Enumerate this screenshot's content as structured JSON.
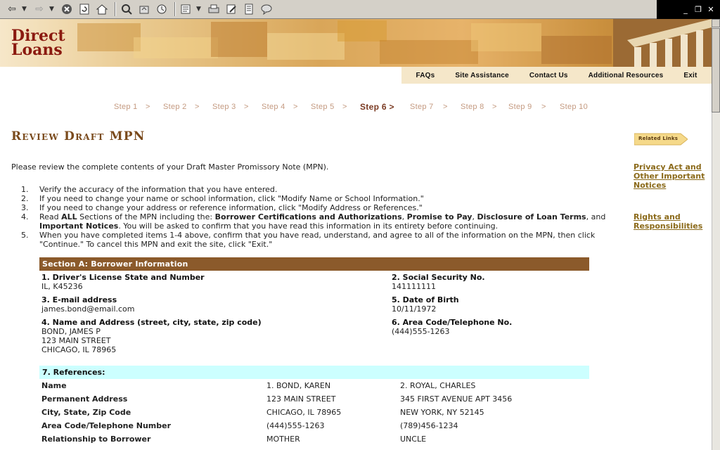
{
  "browser": {
    "toolbar_icons": [
      "back-arrow-icon",
      "dropdown-arrow-icon",
      "forward-arrow-icon",
      "dropdown-arrow-icon",
      "stop-icon",
      "refresh-icon",
      "home-icon",
      "search-icon",
      "favorites-icon",
      "history-icon",
      "mail-icon",
      "print-icon",
      "edit-icon",
      "discuss-icon",
      "messenger-icon"
    ],
    "window_controls": [
      "_",
      "❐",
      "✕"
    ]
  },
  "banner": {
    "logo_line1": "Direct",
    "logo_line2": "Loans"
  },
  "nav": [
    "FAQs",
    "Site Assistance",
    "Contact Us",
    "Additional Resources",
    "Exit"
  ],
  "steps": [
    {
      "label": "Step 1",
      "active": false
    },
    {
      "label": "Step 2",
      "active": false
    },
    {
      "label": "Step 3",
      "active": false
    },
    {
      "label": "Step 4",
      "active": false
    },
    {
      "label": "Step 5",
      "active": false
    },
    {
      "label": "Step 6 >",
      "active": true
    },
    {
      "label": "Step 7",
      "active": false
    },
    {
      "label": "Step 8",
      "active": false
    },
    {
      "label": "Step 9",
      "active": false
    },
    {
      "label": "Step 10",
      "active": false
    }
  ],
  "page_title": "Review Draft MPN",
  "related_links_label": "Related Links",
  "side_links": [
    "Privacy Act and Other Important Notices",
    "Rights and Responsibilities"
  ],
  "intro": "Please review the complete contents of your Draft Master Promissory Note (MPN).",
  "instructions": {
    "i1": "Verify the accuracy of the information that you have entered.",
    "i2": "If you need to change your name or school information, click \"Modify Name or School Information.\"",
    "i3": "If you need to change your address or reference information, click \"Modify Address or References.\"",
    "i4_a": "Read ",
    "i4_b": "ALL",
    "i4_c": " Sections of the MPN including the: ",
    "i4_d": "Borrower Certifications and Authorizations",
    "i4_e": ", ",
    "i4_f": "Promise to Pay",
    "i4_g": ", ",
    "i4_h": "Disclosure of Loan Terms",
    "i4_i": ", and ",
    "i4_j": "Important Notices",
    "i4_k": ". You will be asked to confirm that you have read this information in its entirety before continuing.",
    "i5": "When you have completed items 1-4 above, confirm that you have read, understand, and agree to all of the information on the MPN, then click \"Continue.\" To cancel this MPN and exit the site, click \"Exit.\""
  },
  "section_a": {
    "heading": "Section A: Borrower Information",
    "f1_label": "1. Driver's License State and Number",
    "f1_value": "IL, K45236",
    "f2_label": "2. Social Security No.",
    "f2_value": "141111111",
    "f3_label": "3. E-mail address",
    "f3_value": "james.bond@email.com",
    "f5_label": "5. Date of Birth",
    "f5_value": "10/11/1972",
    "f4_label": "4. Name and Address (street, city, state, zip code)",
    "f4_line1": "BOND, JAMES P",
    "f4_line2": "123 MAIN STREET",
    "f4_line3": "CHICAGO, IL 78965",
    "f6_label": "6. Area Code/Telephone No.",
    "f6_value": "(444)555-1263"
  },
  "references": {
    "heading": "7. References:",
    "rows": [
      {
        "label": "Name",
        "r1": "1. BOND, KAREN",
        "r2": "2. ROYAL, CHARLES"
      },
      {
        "label": "Permanent Address",
        "r1": "123 MAIN STREET",
        "r2": "345 FIRST AVENUE APT 3456"
      },
      {
        "label": "City, State, Zip Code",
        "r1": "CHICAGO, IL 78965",
        "r2": "NEW YORK, NY 52145"
      },
      {
        "label": "Area Code/Telephone Number",
        "r1": "(444)555-1263",
        "r2": "(789)456-1234"
      },
      {
        "label": "Relationship to Borrower",
        "r1": "MOTHER",
        "r2": "UNCLE"
      }
    ]
  },
  "colors": {
    "section_head": "#8b5a2b",
    "refs_head": "#ccffff",
    "title": "#7a4a1c",
    "link": "#8b6a1a",
    "logo": "#8b1a10"
  }
}
